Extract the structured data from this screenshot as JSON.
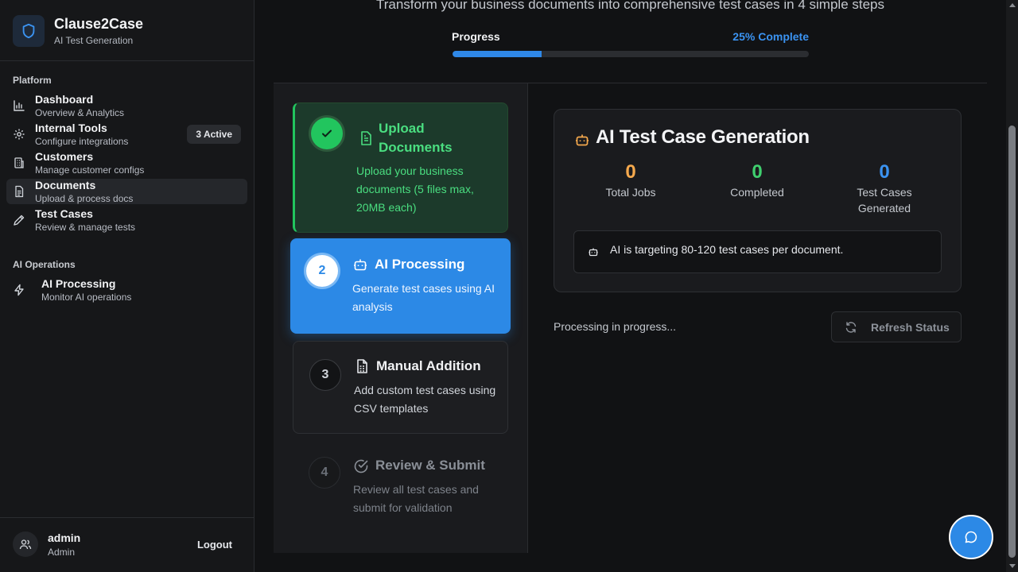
{
  "brand": {
    "title": "Clause2Case",
    "subtitle": "AI Test Generation"
  },
  "sidebar": {
    "sections": [
      {
        "label": "Platform"
      },
      {
        "label": "AI Operations"
      }
    ],
    "items": [
      {
        "title": "Dashboard",
        "desc": "Overview & Analytics",
        "icon": "bar-chart-icon"
      },
      {
        "title": "Internal Tools",
        "desc": "Configure integrations",
        "icon": "gear-icon",
        "badge": "3 Active"
      },
      {
        "title": "Customers",
        "desc": "Manage customer configs",
        "icon": "building-icon"
      },
      {
        "title": "Documents",
        "desc": "Upload & process docs",
        "icon": "document-icon",
        "active": true
      },
      {
        "title": "Test Cases",
        "desc": "Review & manage tests",
        "icon": "pencil-icon"
      },
      {
        "title": "AI Processing",
        "desc": "Monitor AI operations",
        "icon": "lightning-icon"
      }
    ],
    "user": {
      "name": "admin",
      "role": "Admin",
      "logout_label": "Logout"
    }
  },
  "header": {
    "subtitle": "Transform your business documents into comprehensive test cases in 4 simple steps",
    "progress_label": "Progress",
    "progress_text": "25% Complete",
    "progress_fraction": 0.25
  },
  "steps": [
    {
      "number": "",
      "title": "Upload Documents",
      "desc": "Upload your business documents (5 files max, 20MB each)",
      "status": "completed"
    },
    {
      "number": "2",
      "title": "AI Processing",
      "desc": "Generate test cases using AI analysis",
      "status": "active"
    },
    {
      "number": "3",
      "title": "Manual Addition",
      "desc": "Add custom test cases using CSV templates",
      "status": "pending"
    },
    {
      "number": "4",
      "title": "Review & Submit",
      "desc": "Review all test cases and submit for validation",
      "status": "disabled"
    }
  ],
  "generation": {
    "title": "AI Test Case Generation",
    "stats": [
      {
        "value": "0",
        "label": "Total Jobs",
        "color": "#f5a94d"
      },
      {
        "value": "0",
        "label": "Completed",
        "color": "#3fcf6e"
      },
      {
        "value": "0",
        "label": "Test Cases Generated",
        "color": "#3b93f1"
      }
    ],
    "note": "AI is targeting 80-120 test cases per document.",
    "processing_text": "Processing in progress...",
    "refresh_label": "Refresh Status"
  },
  "colors": {
    "accent": "#2c89e6",
    "success": "#22c55e",
    "warning": "#f5a94d"
  }
}
